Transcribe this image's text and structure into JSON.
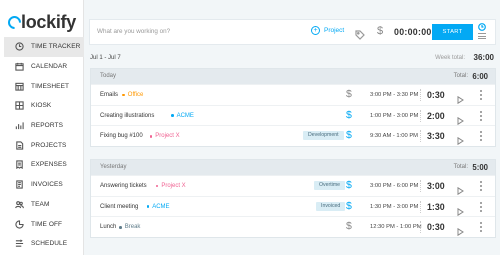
{
  "app": {
    "logo_text": "lockify",
    "brand_color": "#03a9f4"
  },
  "sidebar": {
    "items": [
      {
        "label": "TIME TRACKER",
        "icon": "clock-icon",
        "active": true
      },
      {
        "label": "CALENDAR",
        "icon": "calendar-icon",
        "active": false
      },
      {
        "label": "TIMESHEET",
        "icon": "timesheet-icon",
        "active": false
      },
      {
        "label": "KIOSK",
        "icon": "kiosk-icon",
        "active": false
      },
      {
        "label": "REPORTS",
        "icon": "bar-chart-icon",
        "active": false
      },
      {
        "label": "PROJECTS",
        "icon": "document-icon",
        "active": false
      },
      {
        "label": "EXPENSES",
        "icon": "receipt-icon",
        "active": false
      },
      {
        "label": "INVOICES",
        "icon": "invoice-icon",
        "active": false
      },
      {
        "label": "TEAM",
        "icon": "team-icon",
        "active": false
      },
      {
        "label": "TIME OFF",
        "icon": "time-off-icon",
        "active": false
      },
      {
        "label": "SCHEDULE",
        "icon": "schedule-icon",
        "active": false
      }
    ]
  },
  "timer": {
    "placeholder": "What are you working on?",
    "project_label": "Project",
    "value": "00:00:00",
    "start_label": "START"
  },
  "week": {
    "range": "Jul 1 - Jul 7",
    "total_label": "Week total:",
    "total": "36:00"
  },
  "days": [
    {
      "label": "Today",
      "total_label": "Total:",
      "total": "6:00",
      "entries": [
        {
          "name": "Emails",
          "project": "Office",
          "project_color": "#ff9800",
          "badge": "",
          "billable": false,
          "range": "3:00 PM - 3:30 PM",
          "duration": "0:30"
        },
        {
          "name": "Creating illustrations",
          "project": "ACME",
          "project_color": "#03a9f4",
          "badge": "",
          "billable": true,
          "range": "1:00 PM - 3:00 PM",
          "duration": "2:00"
        },
        {
          "name": "Fixing bug #100",
          "project": "Project X",
          "project_color": "#f06292",
          "badge": "Development",
          "billable": true,
          "range": "9:30 AM - 1:00 PM",
          "duration": "3:30"
        }
      ]
    },
    {
      "label": "Yesterday",
      "total_label": "Total:",
      "total": "5:00",
      "entries": [
        {
          "name": "Answering tickets",
          "project": "Project X",
          "project_color": "#f06292",
          "badge": "Overtime",
          "billable": true,
          "range": "3:00 PM - 6:00 PM",
          "duration": "3:00"
        },
        {
          "name": "Client meeting",
          "project": "ACME",
          "project_color": "#03a9f4",
          "badge": "Invoiced",
          "billable": true,
          "range": "1:30 PM - 3:00 PM",
          "duration": "1:30"
        },
        {
          "name": "Lunch",
          "project": "Break",
          "project_color": "#607d8b",
          "badge": "",
          "billable": false,
          "range": "12:30 PM - 1:00 PM",
          "duration": "0:30"
        }
      ]
    }
  ]
}
